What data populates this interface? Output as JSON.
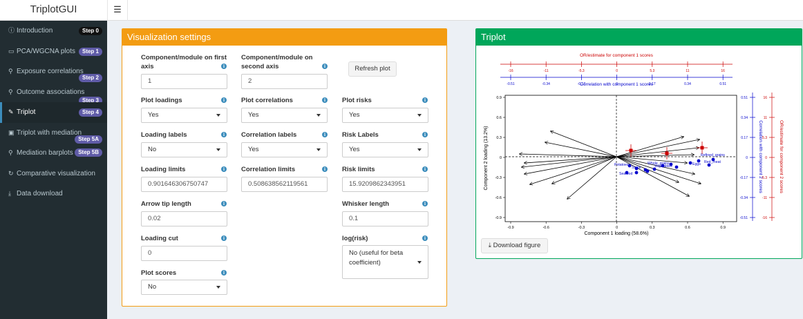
{
  "app": {
    "title": "TriplotGUI",
    "menu_icon": "hamburger-icon"
  },
  "sidebar": {
    "items": [
      {
        "label": "Introduction",
        "icon": "info-icon",
        "badge": "Step 0"
      },
      {
        "label": "PCA/WGCNA plots",
        "icon": "desktop-icon",
        "badge": "Step 1"
      },
      {
        "label": "Exposure correlations",
        "icon": "search-icon",
        "badge": "Step 2"
      },
      {
        "label": "Outcome associations",
        "icon": "search-icon",
        "badge": "Step 3"
      },
      {
        "label": "Triplot",
        "icon": "pencil-icon",
        "badge": "Step 4"
      },
      {
        "label": "Triplot with mediation",
        "icon": "image-icon",
        "badge": "Step 5A"
      },
      {
        "label": "Mediation barplots",
        "icon": "search-icon",
        "badge": "Step 5B"
      },
      {
        "label": "Comparative visualization",
        "icon": "refresh-icon"
      },
      {
        "label": "Data download",
        "icon": "download-icon"
      }
    ]
  },
  "settings": {
    "title": "Visualization settings",
    "comp1": {
      "label": "Component/module on first axis",
      "value": "1"
    },
    "comp2": {
      "label": "Component/module on second axis",
      "value": "2"
    },
    "refresh": "Refresh plot",
    "plot_loadings": {
      "label": "Plot loadings",
      "value": "Yes"
    },
    "plot_correlations": {
      "label": "Plot correlations",
      "value": "Yes"
    },
    "plot_risks": {
      "label": "Plot risks",
      "value": "Yes"
    },
    "loading_labels": {
      "label": "Loading labels",
      "value": "No"
    },
    "correlation_labels": {
      "label": "Correlation labels",
      "value": "Yes"
    },
    "risk_labels": {
      "label": "Risk Labels",
      "value": "Yes"
    },
    "loading_limits": {
      "label": "Loading limits",
      "value": "0.901646306750747"
    },
    "correlation_limits": {
      "label": "Correlation limits",
      "value": "0.508638562119561"
    },
    "risk_limits": {
      "label": "Risk limits",
      "value": "15.9209862343951"
    },
    "arrow_tip": {
      "label": "Arrow tip length",
      "value": "0.02"
    },
    "whisker": {
      "label": "Whisker length",
      "value": "0.1"
    },
    "loading_cut": {
      "label": "Loading cut",
      "value": "0"
    },
    "log_risk": {
      "label": "log(risk)",
      "value": "No (useful for beta coefficient)"
    },
    "plot_scores": {
      "label": "Plot scores",
      "value": "No"
    }
  },
  "triplot": {
    "title": "Triplot",
    "download": "Download figure",
    "xlabel": "Component 1 loading (58.6%)",
    "ylabel": "Component 2 loading (13.2%)",
    "top_red_label": "OR/estimate for component 1 scores",
    "top_blue_label": "Correlation with component 1 scores",
    "right_blue_label": "Correlation with component 2 scores",
    "right_red_label": "OR/estimate for component 2 scores",
    "x_ticks": [
      "-0.9",
      "-0.6",
      "-0.3",
      "0",
      "0.3",
      "0.6",
      "0.9"
    ],
    "y_ticks": [
      "0.9",
      "0.6",
      "0.3",
      "0",
      "-0.3",
      "-0.6",
      "-0.9"
    ],
    "top_red_ticks": [
      "-16",
      "-11",
      "-5.3",
      "0",
      "5.3",
      "11",
      "16"
    ],
    "top_blue_ticks": [
      "-0.51",
      "-0.34",
      "-0.17",
      "0",
      "0.17",
      "0.34",
      "0.51"
    ],
    "right_blue_ticks": [
      "0.51",
      "0.34",
      "0.17",
      "0",
      "-0.17",
      "-0.34",
      "-0.51"
    ],
    "right_red_ticks": [
      "16",
      "11",
      "5.3",
      "0",
      "-5.3",
      "-11",
      "-16"
    ],
    "correlation_labels": [
      "Refined_grains",
      "Red_meat",
      "Eggs",
      "Vegetables",
      "Potatoes",
      "Sugar",
      "Whole_grains",
      "Seafood"
    ],
    "colors": {
      "loading": "#000000",
      "correlation": "#0000cc",
      "risk": "#cc0000"
    }
  }
}
